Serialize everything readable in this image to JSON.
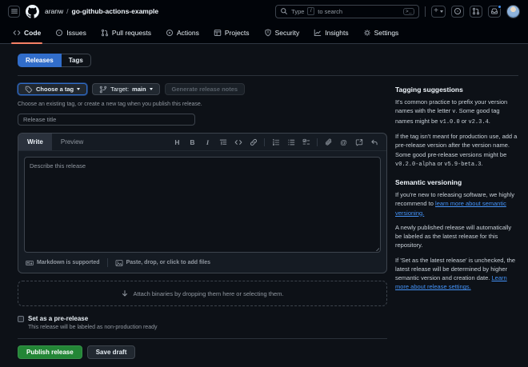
{
  "header": {
    "breadcrumb": {
      "owner": "aranw",
      "separator": "/",
      "repo": "go-github-actions-example"
    },
    "search": {
      "placeholder_prefix": "Type",
      "slash_key": "/",
      "placeholder_suffix": "to search",
      "command_hint": ">_"
    },
    "action_icons": [
      "plus",
      "issue-opened",
      "pull-request",
      "inbox"
    ],
    "logo_icon": "github-mark",
    "menu_icon": "hamburger",
    "avatar": "user-avatar",
    "notification_dot_color": "#4493f8"
  },
  "nav": {
    "tabs": [
      {
        "label": "Code",
        "icon": "code",
        "active": true
      },
      {
        "label": "Issues",
        "icon": "issue-opened",
        "active": false
      },
      {
        "label": "Pull requests",
        "icon": "pull-request",
        "active": false
      },
      {
        "label": "Actions",
        "icon": "play",
        "active": false
      },
      {
        "label": "Projects",
        "icon": "table",
        "active": false
      },
      {
        "label": "Security",
        "icon": "shield",
        "active": false
      },
      {
        "label": "Insights",
        "icon": "graph",
        "active": false
      },
      {
        "label": "Settings",
        "icon": "gear",
        "active": false
      }
    ],
    "active_underline_color": "#f78166"
  },
  "view_switch": {
    "releases": "Releases",
    "tags": "Tags",
    "active": "Releases",
    "active_color": "#316dca"
  },
  "controls": {
    "choose_tag_label": "Choose a tag",
    "target_label": "Target:",
    "target_branch": "main",
    "generate_notes_label": "Generate release notes",
    "caption": "Choose an existing tag, or create a new tag when you publish this release."
  },
  "form": {
    "title_placeholder": "Release title",
    "editor": {
      "write_tab": "Write",
      "preview_tab": "Preview",
      "body_placeholder": "Describe this release",
      "toolbar_groups": [
        [
          "heading",
          "bold",
          "italic",
          "quote",
          "code",
          "link"
        ],
        [
          "ordered-list",
          "unordered-list",
          "task-list"
        ],
        [
          "paperclip",
          "mention",
          "cross-reference",
          "reply"
        ]
      ],
      "markdown_note": "Markdown is supported",
      "markdown_icon": "markdown",
      "paste_note": "Paste, drop, or click to add files",
      "paste_icon": "image"
    },
    "attach_text": "Attach binaries by dropping them here or selecting them.",
    "attach_icon": "arrow-down",
    "prerelease": {
      "label": "Set as a pre-release",
      "description": "This release will be labeled as non-production ready",
      "checked": false
    },
    "publish_label": "Publish release",
    "publish_color": "#238636",
    "save_draft_label": "Save draft"
  },
  "sidebar": {
    "sections": [
      {
        "heading": "Tagging suggestions",
        "paragraphs": [
          [
            {
              "t": "It's common practice to prefix your version names with the letter "
            },
            {
              "t": "v",
              "c": "code"
            },
            {
              "t": ". Some good tag names might be "
            },
            {
              "t": "v1.0.0",
              "c": "code"
            },
            {
              "t": " or "
            },
            {
              "t": "v2.3.4",
              "c": "code"
            },
            {
              "t": "."
            }
          ],
          [
            {
              "t": "If the tag isn't meant for production use, add a pre-release version after the version name. Some good pre-release versions might be "
            },
            {
              "t": "v0.2.0-alpha",
              "c": "code"
            },
            {
              "t": " or "
            },
            {
              "t": "v5.9-beta.3",
              "c": "code"
            },
            {
              "t": "."
            }
          ]
        ]
      },
      {
        "heading": "Semantic versioning",
        "paragraphs": [
          [
            {
              "t": "If you're new to releasing software, we highly recommend to "
            },
            {
              "t": "learn more about semantic versioning.",
              "c": "link"
            }
          ],
          [
            {
              "t": "A newly published release will automatically be labeled as the latest release for this repository."
            }
          ],
          [
            {
              "t": "If 'Set as the latest release' is unchecked, the latest release will be determined by higher semantic version and creation date. "
            },
            {
              "t": "Learn more about release settings.",
              "c": "link"
            }
          ]
        ]
      }
    ],
    "link_color": "#4493f8"
  },
  "colors": {
    "page_bg": "#0d1117",
    "header_bg": "#010409",
    "border": "#30363d",
    "text": "#e6edf3",
    "muted": "#9198a1"
  }
}
